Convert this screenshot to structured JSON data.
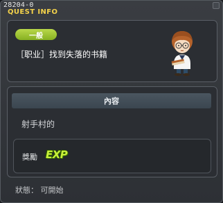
{
  "window": {
    "id": "28204-0",
    "title": "QUEST INFO"
  },
  "quest": {
    "category": "一般",
    "title": "［职业］找到失落的书籍"
  },
  "content": {
    "header": "內容",
    "text": "射手村的",
    "reward_label": "獎勵",
    "reward_icon_text": "EXP"
  },
  "status": {
    "text": "狀態： 可開始"
  },
  "colors": {
    "title_accent": "#f4d24a",
    "badge_green": "#9cc331",
    "exp_green": "#c8f03a"
  },
  "icons": {
    "npc": "npc-portrait",
    "reward": "exp-icon"
  }
}
